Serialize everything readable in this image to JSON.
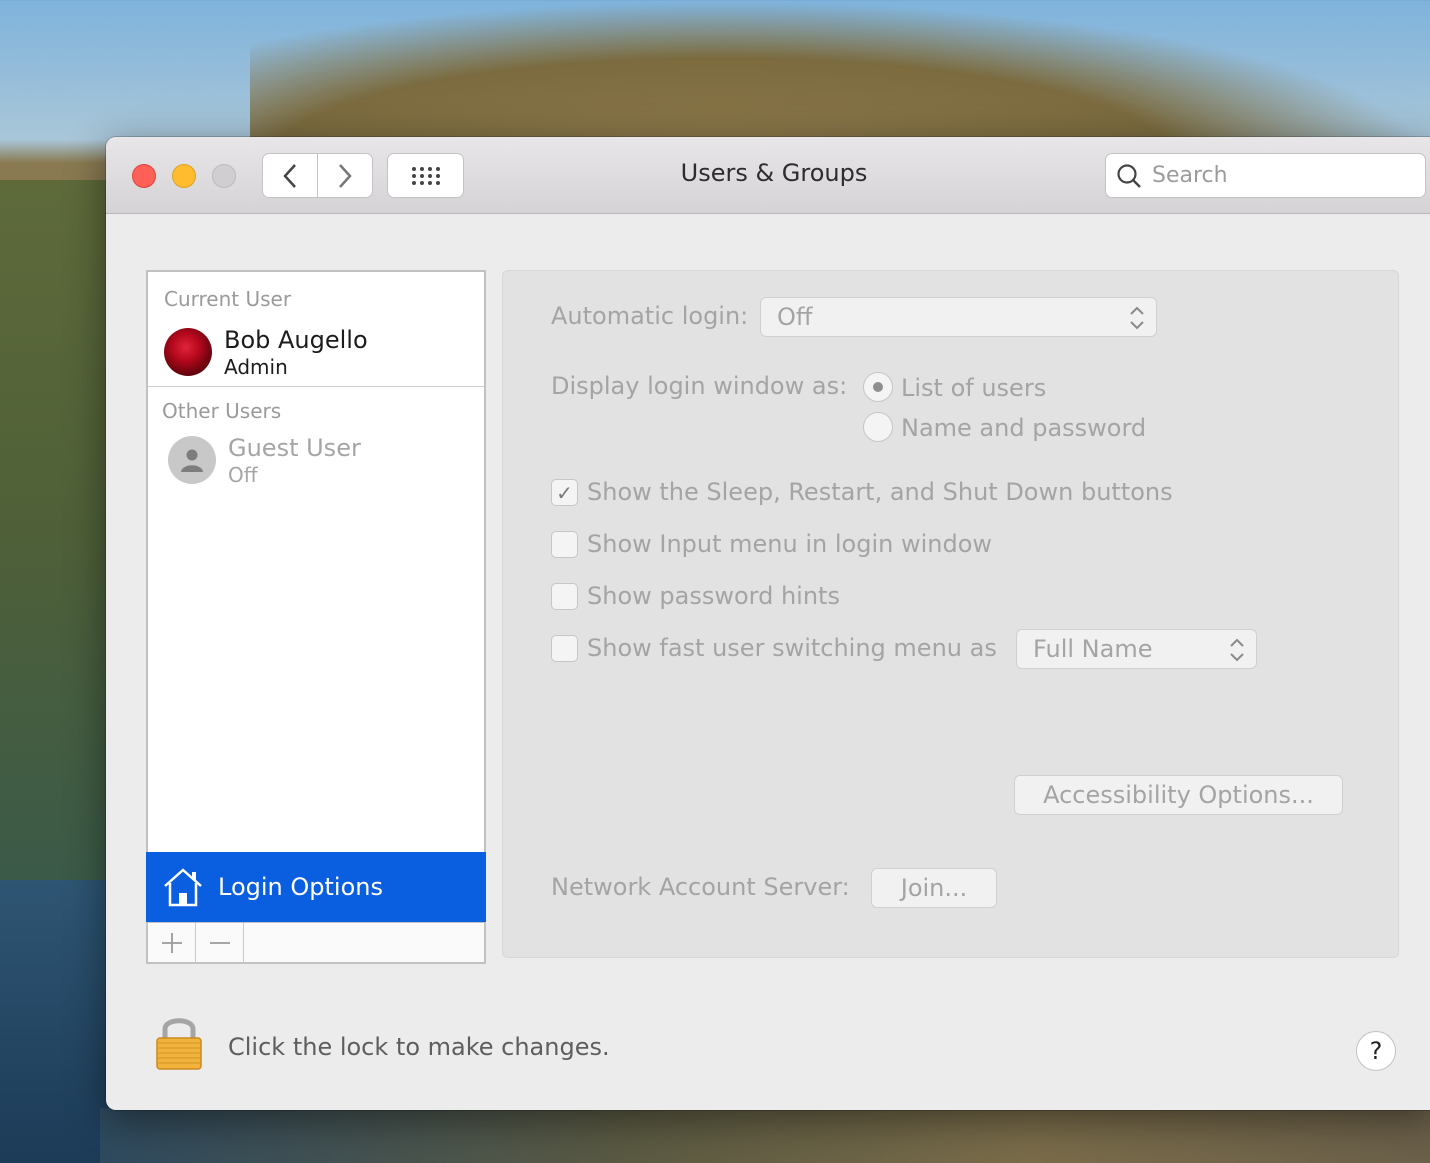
{
  "window": {
    "title": "Users & Groups"
  },
  "search": {
    "placeholder": "Search"
  },
  "sidebar": {
    "current_user_heading": "Current User",
    "current_user": {
      "name": "Bob Augello",
      "role": "Admin"
    },
    "other_users_heading": "Other Users",
    "other_users": [
      {
        "name": "Guest User",
        "status": "Off"
      }
    ],
    "login_options_label": "Login Options"
  },
  "panel": {
    "automatic_login_label": "Automatic login:",
    "automatic_login_value": "Off",
    "display_login_label": "Display login window as:",
    "display_options": [
      {
        "label": "List of users",
        "selected": true
      },
      {
        "label": "Name and password",
        "selected": false
      }
    ],
    "checkboxes": [
      {
        "label": "Show the Sleep, Restart, and Shut Down buttons",
        "checked": true
      },
      {
        "label": "Show Input menu in login window",
        "checked": false
      },
      {
        "label": "Show password hints",
        "checked": false
      },
      {
        "label": "Show fast user switching menu as",
        "checked": false
      }
    ],
    "fast_switch_value": "Full Name",
    "accessibility_button": "Accessibility Options...",
    "network_label": "Network Account Server:",
    "join_button": "Join..."
  },
  "footer": {
    "lock_text": "Click the lock to make changes.",
    "help": "?"
  },
  "colors": {
    "selection": "#0a5ee0",
    "close": "#fe5f57",
    "minimize": "#febc2e"
  }
}
